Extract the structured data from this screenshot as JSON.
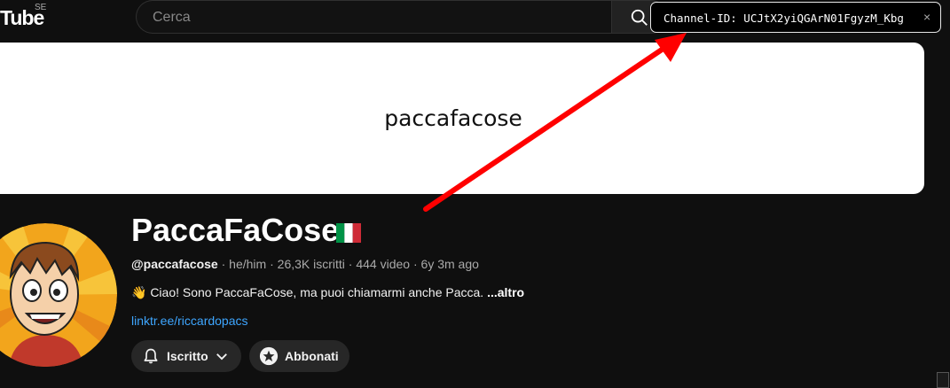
{
  "masthead": {
    "logo_text": "Tube",
    "logo_country": "SE",
    "search": {
      "placeholder": "Cerca",
      "value": ""
    },
    "search_icon": "search-icon"
  },
  "tooltip": {
    "text": "Channel-ID: UCJtX2yiQGArN01FgyzM_Kbg",
    "close": "×"
  },
  "annotation": {
    "arrow_color": "#ff0000"
  },
  "banner": {
    "text": "paccafacose",
    "background": "#ffffff"
  },
  "channel": {
    "name": "PaccaFaCose",
    "flag_icon": "italy-flag-icon",
    "handle": "@paccafacose",
    "separator": " · ",
    "pronouns": "he/him",
    "subscribers": "26,3K iscritti",
    "videos": "444 video",
    "age": "6y 3m ago",
    "description": "👋 Ciao! Sono PaccaFaCose, ma puoi chiamarmi anche Pacca. ",
    "description_more": "...altro",
    "link": "linktr.ee/riccardopacs"
  },
  "actions": {
    "subscribed_label": "Iscritto",
    "join_label": "Abbonati"
  },
  "colors": {
    "background": "#0f0f0f",
    "link": "#3ea6ff",
    "button_bg": "#272727",
    "avatar_bg": "#f2a51c"
  }
}
